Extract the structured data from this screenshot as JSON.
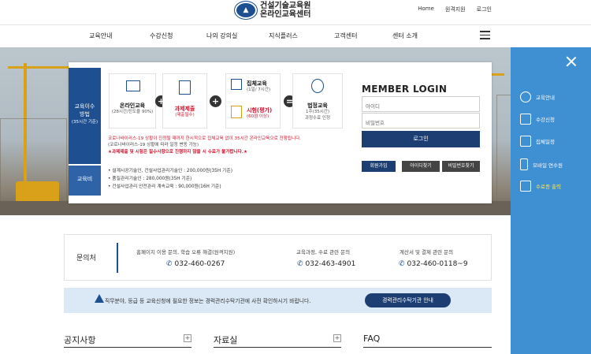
{
  "header": {
    "logo_line1": "건설기술교육원",
    "logo_line2": "온라인교육센터",
    "util_links": [
      "Home",
      "원격지원",
      "로그인"
    ]
  },
  "nav": [
    "교육안내",
    "수강신청",
    "나의 강의실",
    "지식플러스",
    "고객센터",
    "센터 소개"
  ],
  "hero": {
    "label_top": [
      "교육이수",
      "방법",
      "(35시간 기준)"
    ],
    "label_fee": "교육비",
    "steps": [
      {
        "title": "온라인교육",
        "sub": "(28시간/진도율 90%)"
      },
      {
        "title": "과제제출",
        "sub": "(제출필수)"
      },
      {
        "title": "집체교육",
        "sub": "(1일/ 7시간)"
      },
      {
        "title": "시험(평가)",
        "sub": "(60점 이상)"
      },
      {
        "title": "법정교육",
        "sub1": "1주(35시간)",
        "sub2": "과정수료 인정"
      }
    ],
    "operators": [
      "+",
      "+",
      "="
    ],
    "notes": [
      "코로나바이러스-19 상황이 진정될 때까지 한시적으로 집체교육 없이 35시간 온라인교육으로 진행됩니다.",
      "(코로나바이러스-19 상황에 따라 일정 변동 가능)",
      "★과제제출 및 시험은 필수사항으로 진행하지 않을 시 수료가 불가합니다.★"
    ],
    "fees": [
      "• 설계시공기술인, 건설사업관리기술인 : 200,000원(35H 기준)",
      "• 품질관리기술인 : 280,000원(35H 기준)",
      "• 건설사업관리 안전관리 계속교육 : 90,000원(16H 기준)"
    ]
  },
  "login": {
    "title": "MEMBER LOGIN",
    "id_placeholder": "아이디",
    "pw_placeholder": "비밀번호",
    "login_label": "로그인",
    "join": "회원가입",
    "find_id": "아이디찾기",
    "find_pw": "비밀번호찾기"
  },
  "quick_menu": {
    "items": [
      "교육안내",
      "수강신청",
      "집체일정",
      "모바일 연수원",
      "수료증 출력"
    ]
  },
  "contact": {
    "title": "문의처",
    "items": [
      {
        "desc": "홈페이지 이용 문의, 학습 오류 해결(원격지원)",
        "phone": "032-460-0267"
      },
      {
        "desc": "교육과정, 수료 관련 문의",
        "phone": "032-463-4901"
      },
      {
        "desc": "계산서 및 결제 관련 문의",
        "phone": "032-460-0118~9"
      }
    ]
  },
  "notice_bar": {
    "text": "직무분야, 등급 등 교육신청에 필요한 정보는 경력관리수탁기관에 사전 확인하시기 바랍니다.",
    "button": "경력관리수탁기관 안내"
  },
  "sections": [
    "공지사항",
    "자료실",
    "FAQ"
  ],
  "colors": {
    "brand": "#1d4f91",
    "quick_panel": "#3f8fd3",
    "highlight": "#d0142e"
  }
}
